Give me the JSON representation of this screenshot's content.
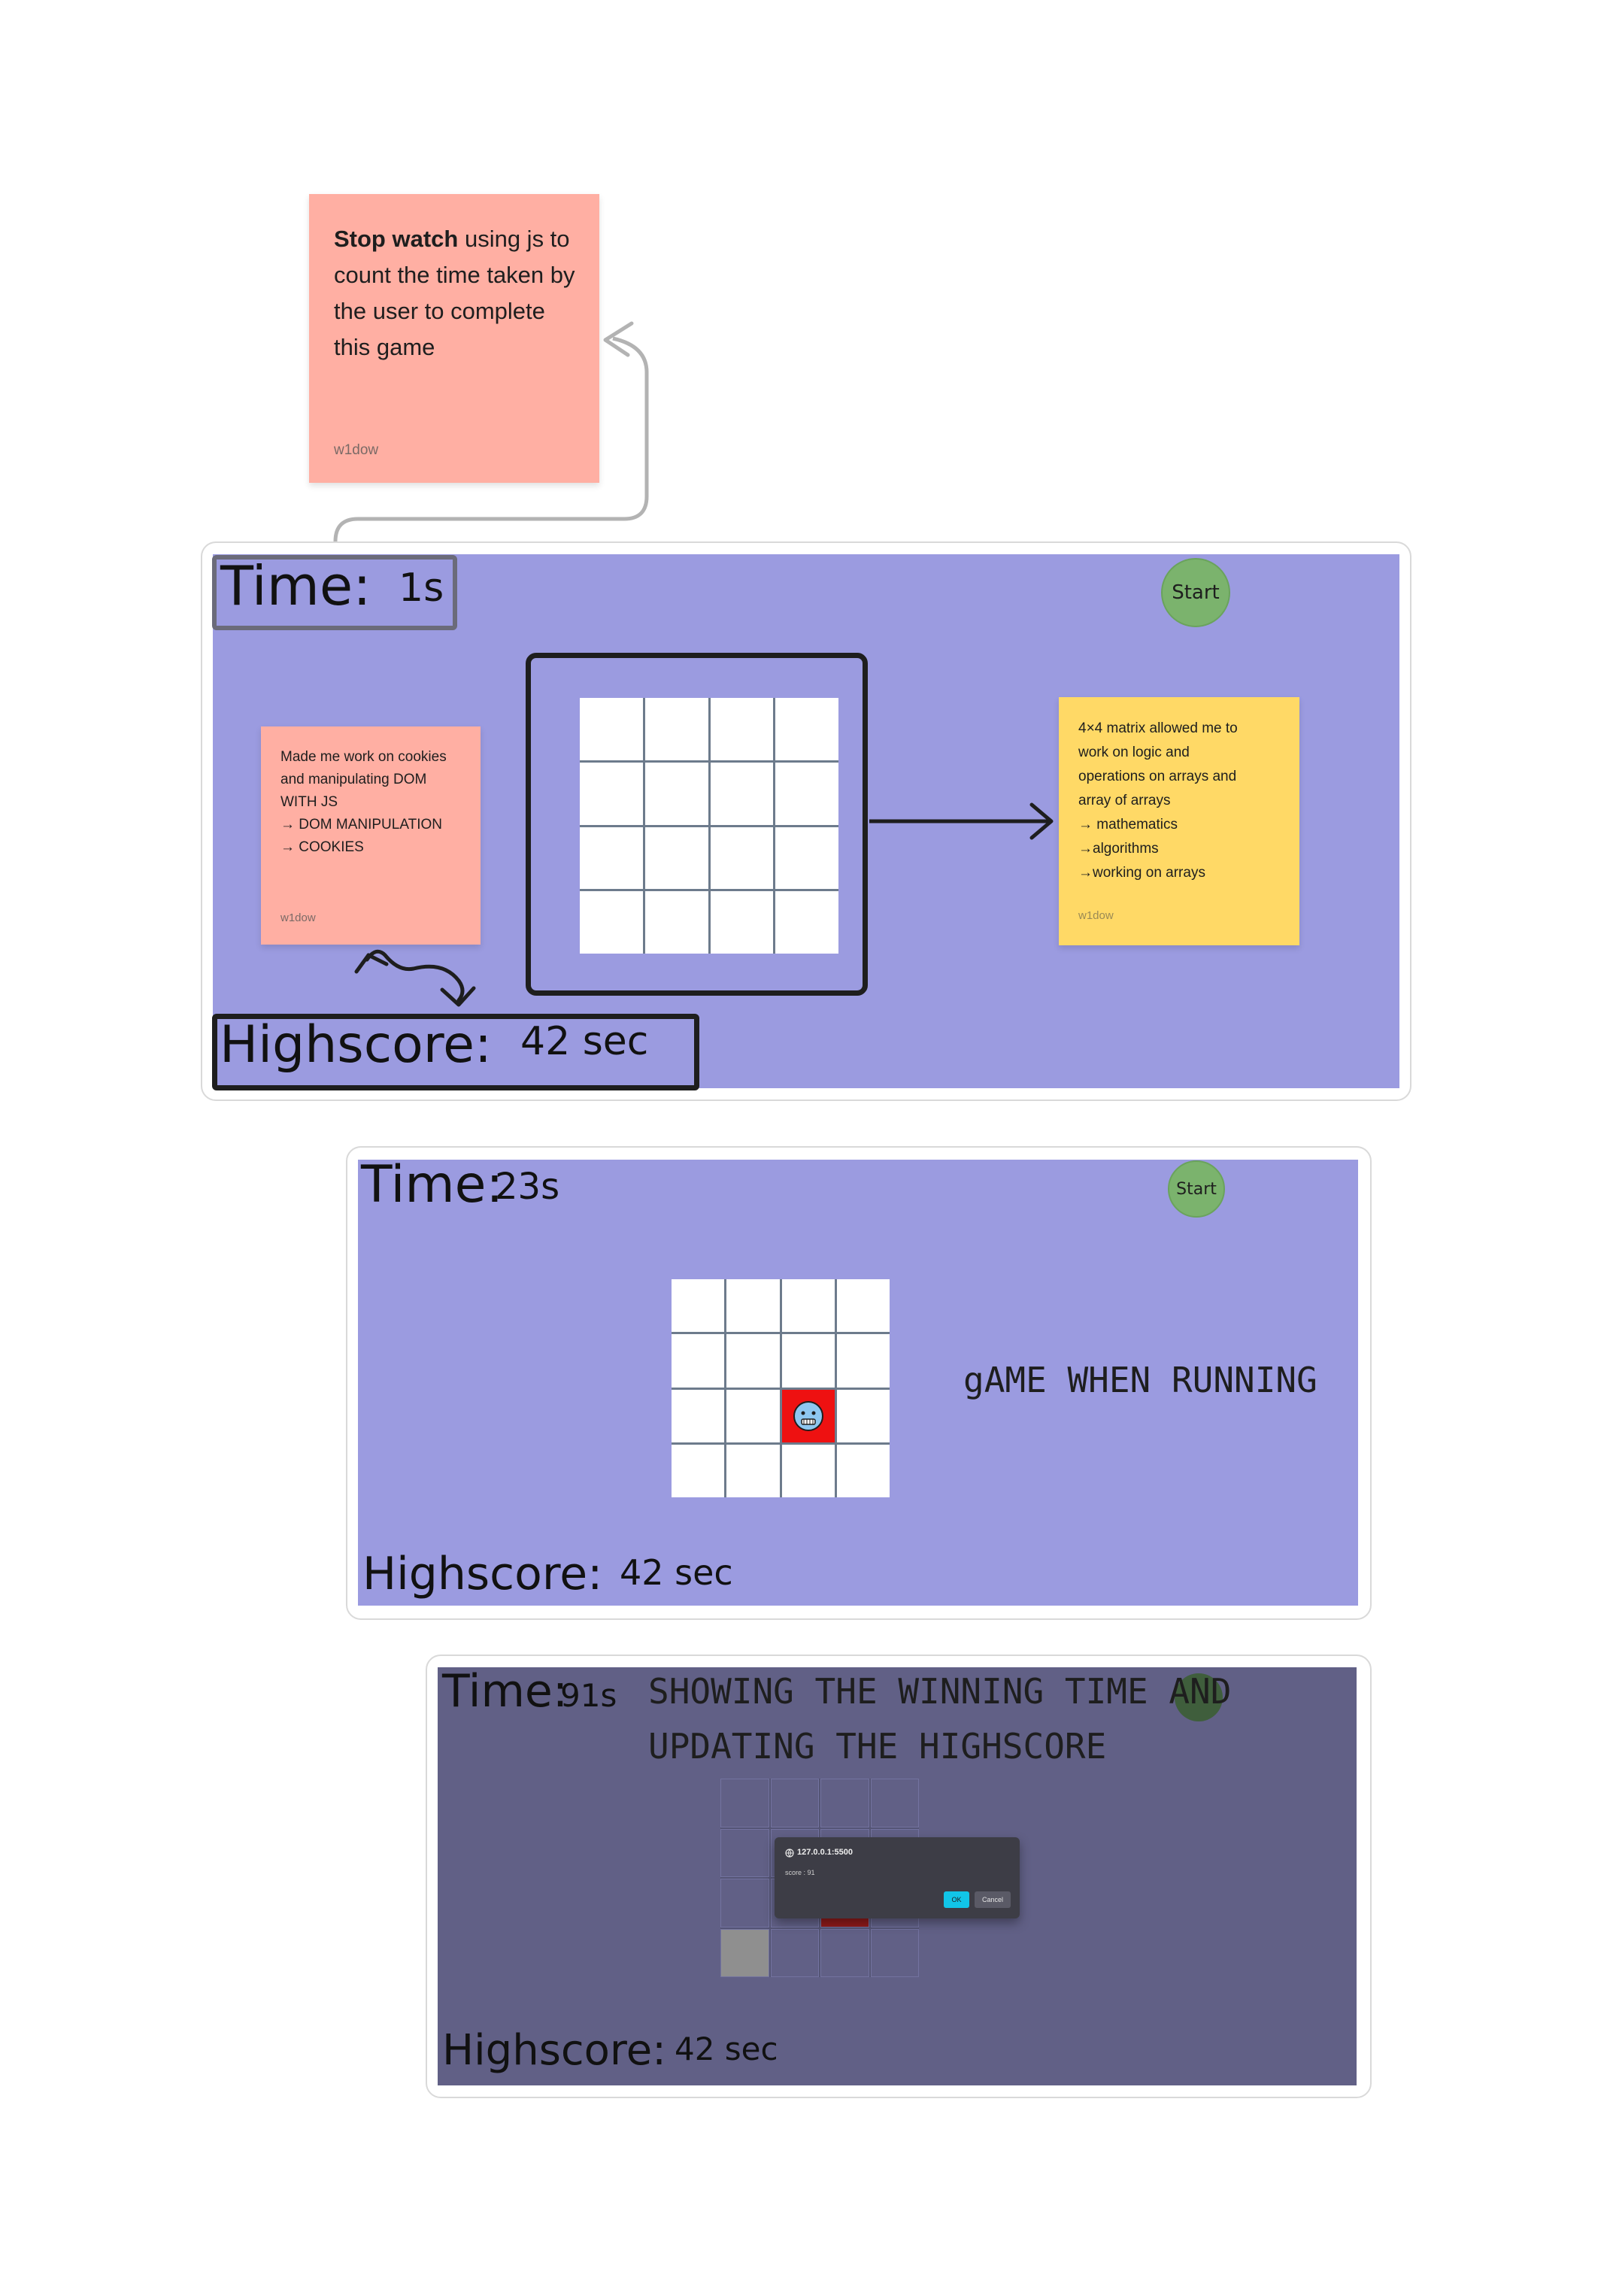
{
  "note_stopwatch": {
    "bold": "Stop watch",
    "rest": " using js to count the time taken by the user to complete this game",
    "author": "w1dow",
    "color": "#ffafa3"
  },
  "frame1": {
    "time_label": "Time:",
    "time_value": "1s",
    "start_label": "Start",
    "highscore_label": "Highscore:",
    "highscore_value": "42 sec",
    "note_cookies": {
      "text": "Made me work on cookies\nand manipulating DOM\nWITH JS\n→ DOM MANIPULATION\n→ COOKIES",
      "author": "w1dow"
    },
    "note_matrix": {
      "text": "4×4 matrix allowed me to\nwork on logic and\noperations on arrays and\narray of arrays\n→ mathematics\n→algorithms\n→working on arrays",
      "author": "w1dow",
      "color": "#ffd966"
    }
  },
  "frame2": {
    "time_label": "Time:",
    "time_value": "23s",
    "start_label": "Start",
    "caption": "gAME WHEN RUNNING",
    "highscore_label": "Highscore:",
    "highscore_value": "42 sec",
    "active_cell_icon": "cold-face-icon"
  },
  "frame3": {
    "time_label": "Time:",
    "time_value": "91s",
    "caption_line1": "SHOWING THE WINNING TIME AND",
    "caption_line2": "UPDATING THE HIGHSCORE",
    "highscore_label": "Highscore:",
    "highscore_value": "42 sec",
    "dialog": {
      "origin": "127.0.0.1:5500",
      "message": "score : 91",
      "ok_label": "OK",
      "cancel_label": "Cancel"
    }
  },
  "colors": {
    "panel": "#9b9be0",
    "panel_dim": "#616086",
    "start": "#7bb36d",
    "active_cell": "#ee1111"
  }
}
